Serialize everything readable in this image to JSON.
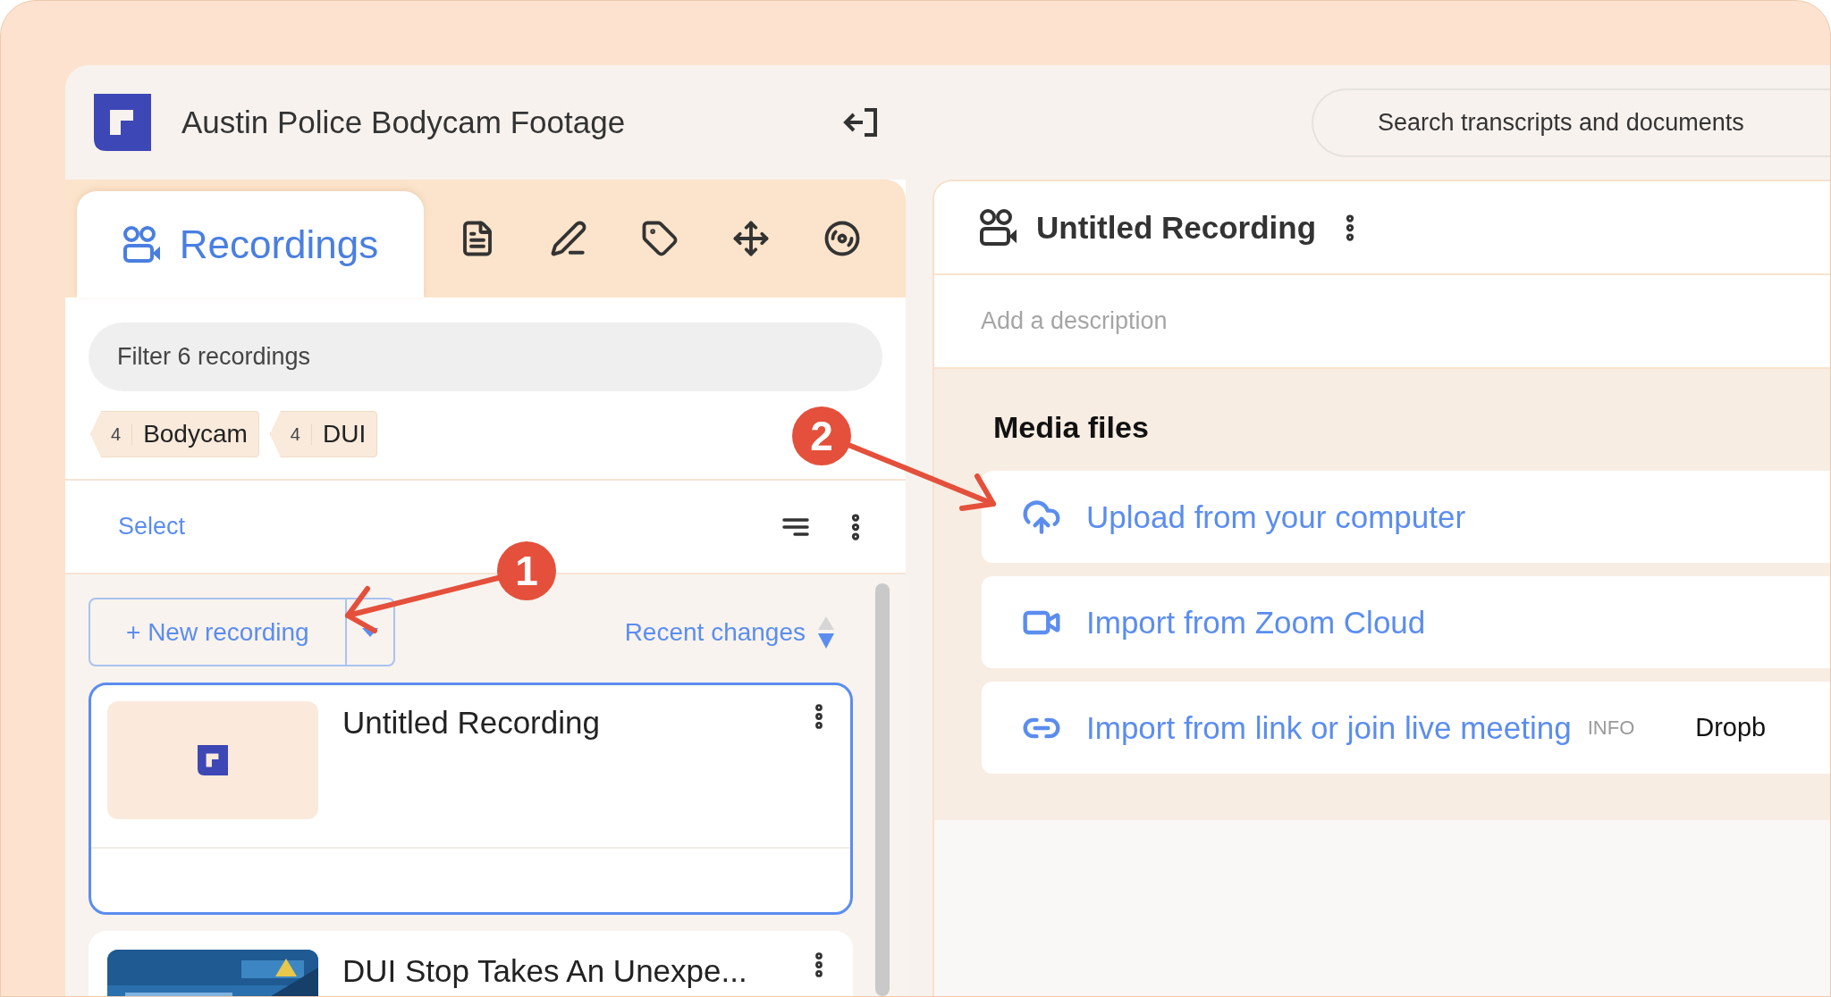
{
  "app": {
    "title": "Austin Police Bodycam Footage"
  },
  "search": {
    "placeholder": "Search transcripts and documents"
  },
  "tabs": [
    {
      "kind": "recordings",
      "label": "Recordings",
      "selected": true
    },
    {
      "kind": "document",
      "selected": false
    },
    {
      "kind": "pen",
      "selected": false
    },
    {
      "kind": "tag",
      "selected": false
    },
    {
      "kind": "move",
      "selected": false
    },
    {
      "kind": "reel",
      "selected": false
    }
  ],
  "filter": {
    "placeholder": "Filter 6 recordings"
  },
  "tags": [
    {
      "count": "4",
      "label": "Bodycam"
    },
    {
      "count": "4",
      "label": "DUI"
    }
  ],
  "select_link": "Select",
  "new_recording": "+ New recording",
  "sort": "Recent changes",
  "recordings": [
    {
      "title": "Untitled Recording",
      "selected": true,
      "thumbnail": {
        "kind": "logo"
      }
    },
    {
      "title": "DUI Stop Takes An Unexpe...",
      "selected": false
    }
  ],
  "detail": {
    "title": "Untitled Recording",
    "description_placeholder": "Add a description",
    "section": "Media files",
    "options": [
      {
        "kind": "upload",
        "label": "Upload from your computer"
      },
      {
        "kind": "zoom",
        "label": "Import from Zoom Cloud"
      },
      {
        "kind": "link",
        "label": "Import from link or join live meeting",
        "note": "INFO",
        "extra": "Dropb"
      }
    ]
  },
  "annotations": [
    {
      "label": "1"
    },
    {
      "label": "2"
    }
  ]
}
